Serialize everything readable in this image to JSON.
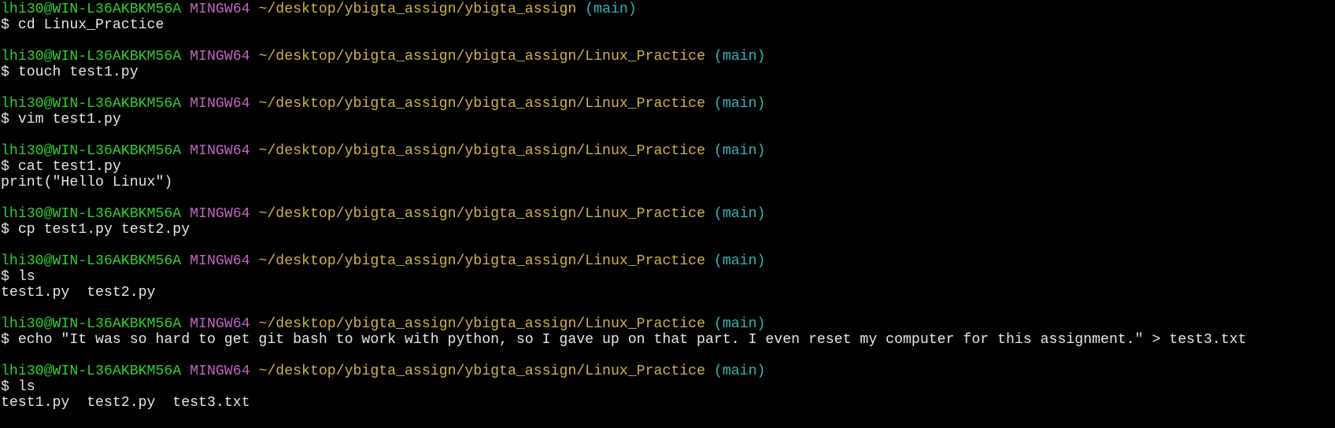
{
  "colors": {
    "background": "#000000",
    "user_host": "#2fd02f",
    "system": "#c264c2",
    "path": "#cfb24a",
    "branch": "#2fb6b6",
    "text": "#e6e6e6"
  },
  "session": [
    {
      "prompt": {
        "user_host": "lhi30@WIN-L36AKBKM56A",
        "system": "MINGW64",
        "path": "~/desktop/ybigta_assign/ybigta_assign",
        "branch": "(main)"
      },
      "command": "$ cd Linux_Practice",
      "output": []
    },
    {
      "prompt": {
        "user_host": "lhi30@WIN-L36AKBKM56A",
        "system": "MINGW64",
        "path": "~/desktop/ybigta_assign/ybigta_assign/Linux_Practice",
        "branch": "(main)"
      },
      "command": "$ touch test1.py",
      "output": []
    },
    {
      "prompt": {
        "user_host": "lhi30@WIN-L36AKBKM56A",
        "system": "MINGW64",
        "path": "~/desktop/ybigta_assign/ybigta_assign/Linux_Practice",
        "branch": "(main)"
      },
      "command": "$ vim test1.py",
      "output": []
    },
    {
      "prompt": {
        "user_host": "lhi30@WIN-L36AKBKM56A",
        "system": "MINGW64",
        "path": "~/desktop/ybigta_assign/ybigta_assign/Linux_Practice",
        "branch": "(main)"
      },
      "command": "$ cat test1.py",
      "output": [
        "print(\"Hello Linux\")"
      ]
    },
    {
      "prompt": {
        "user_host": "lhi30@WIN-L36AKBKM56A",
        "system": "MINGW64",
        "path": "~/desktop/ybigta_assign/ybigta_assign/Linux_Practice",
        "branch": "(main)"
      },
      "command": "$ cp test1.py test2.py",
      "output": []
    },
    {
      "prompt": {
        "user_host": "lhi30@WIN-L36AKBKM56A",
        "system": "MINGW64",
        "path": "~/desktop/ybigta_assign/ybigta_assign/Linux_Practice",
        "branch": "(main)"
      },
      "command": "$ ls",
      "output": [
        "test1.py  test2.py"
      ]
    },
    {
      "prompt": {
        "user_host": "lhi30@WIN-L36AKBKM56A",
        "system": "MINGW64",
        "path": "~/desktop/ybigta_assign/ybigta_assign/Linux_Practice",
        "branch": "(main)"
      },
      "command": "$ echo \"It was so hard to get git bash to work with python, so I gave up on that part. I even reset my computer for this assignment.\" > test3.txt",
      "output": []
    },
    {
      "prompt": {
        "user_host": "lhi30@WIN-L36AKBKM56A",
        "system": "MINGW64",
        "path": "~/desktop/ybigta_assign/ybigta_assign/Linux_Practice",
        "branch": "(main)"
      },
      "command": "$ ls",
      "output": [
        "test1.py  test2.py  test3.txt"
      ]
    }
  ]
}
